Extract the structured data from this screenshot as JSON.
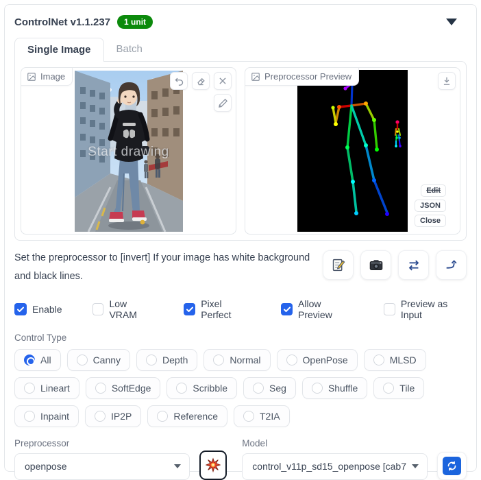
{
  "header": {
    "title": "ControlNet v1.1.237",
    "badge": "1 unit",
    "badge_color": "#0c8a0c",
    "collapse_icon": "triangle-down"
  },
  "tabs": [
    {
      "label": "Single Image",
      "active": true
    },
    {
      "label": "Batch",
      "active": false
    }
  ],
  "image_panel": {
    "label": "Image",
    "watermark": "Start drawing",
    "tool_icons": [
      "undo-icon",
      "eraser-icon",
      "clear-icon",
      "sketch-pen-icon"
    ]
  },
  "preview_panel": {
    "label": "Preprocessor Preview",
    "download_icon": "download-icon",
    "buttons": {
      "edit": "Edit",
      "json": "JSON",
      "close": "Close"
    }
  },
  "note": {
    "text": "Set the preprocessor to [invert] If your image has white background and black lines."
  },
  "action_icons": [
    "new-canvas-icon",
    "webcam-icon",
    "mirror-webcam-icon",
    "send-dimensions-icon"
  ],
  "checkboxes": [
    {
      "label": "Enable",
      "checked": true
    },
    {
      "label": "Low VRAM",
      "checked": false
    },
    {
      "label": "Pixel Perfect",
      "checked": true
    },
    {
      "label": "Allow Preview",
      "checked": true
    },
    {
      "label": "Preview as Input",
      "checked": false
    }
  ],
  "control_type": {
    "label": "Control Type",
    "options": [
      {
        "label": "All",
        "selected": true
      },
      {
        "label": "Canny",
        "selected": false
      },
      {
        "label": "Depth",
        "selected": false
      },
      {
        "label": "Normal",
        "selected": false
      },
      {
        "label": "OpenPose",
        "selected": false
      },
      {
        "label": "MLSD",
        "selected": false
      },
      {
        "label": "Lineart",
        "selected": false
      },
      {
        "label": "SoftEdge",
        "selected": false
      },
      {
        "label": "Scribble",
        "selected": false
      },
      {
        "label": "Seg",
        "selected": false
      },
      {
        "label": "Shuffle",
        "selected": false
      },
      {
        "label": "Tile",
        "selected": false
      },
      {
        "label": "Inpaint",
        "selected": false
      },
      {
        "label": "IP2P",
        "selected": false
      },
      {
        "label": "Reference",
        "selected": false
      },
      {
        "label": "T2IA",
        "selected": false
      }
    ]
  },
  "preprocessor": {
    "label": "Preprocessor",
    "value": "openpose"
  },
  "model": {
    "label": "Model",
    "value": "control_v11p_sd15_openpose [cab7"
  },
  "colors": {
    "accent_blue": "#2563eb",
    "border_gray": "#e3e6ea",
    "text_dark": "#374151"
  }
}
